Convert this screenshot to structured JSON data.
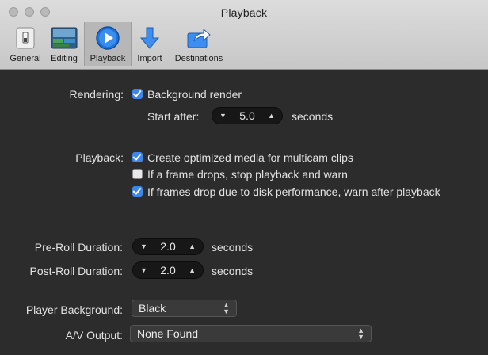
{
  "window": {
    "title": "Playback"
  },
  "toolbar": {
    "items": [
      {
        "label": "General",
        "icon": "general-switch-icon"
      },
      {
        "label": "Editing",
        "icon": "editing-timeline-icon"
      },
      {
        "label": "Playback",
        "icon": "playback-play-icon",
        "selected": true
      },
      {
        "label": "Import",
        "icon": "import-arrow-icon"
      },
      {
        "label": "Destinations",
        "icon": "destinations-share-icon"
      }
    ]
  },
  "rendering": {
    "label": "Rendering:",
    "background_render": {
      "text": "Background render",
      "checked": true
    },
    "start_after": {
      "label": "Start after:",
      "value": "5.0",
      "unit": "seconds"
    }
  },
  "playback": {
    "label": "Playback:",
    "options": [
      {
        "text": "Create optimized media for multicam clips",
        "checked": true
      },
      {
        "text": "If a frame drops, stop playback and warn",
        "checked": false
      },
      {
        "text": "If frames drop due to disk performance, warn after playback",
        "checked": true
      }
    ]
  },
  "preroll": {
    "label": "Pre-Roll Duration:",
    "value": "2.0",
    "unit": "seconds"
  },
  "postroll": {
    "label": "Post-Roll Duration:",
    "value": "2.0",
    "unit": "seconds"
  },
  "player_background": {
    "label": "Player Background:",
    "value": "Black"
  },
  "av_output": {
    "label": "A/V Output:",
    "value": "None Found"
  },
  "colors": {
    "accent": "#3c87e8",
    "background": "#2c2c2c",
    "toolbar": "#d0d0d0"
  }
}
